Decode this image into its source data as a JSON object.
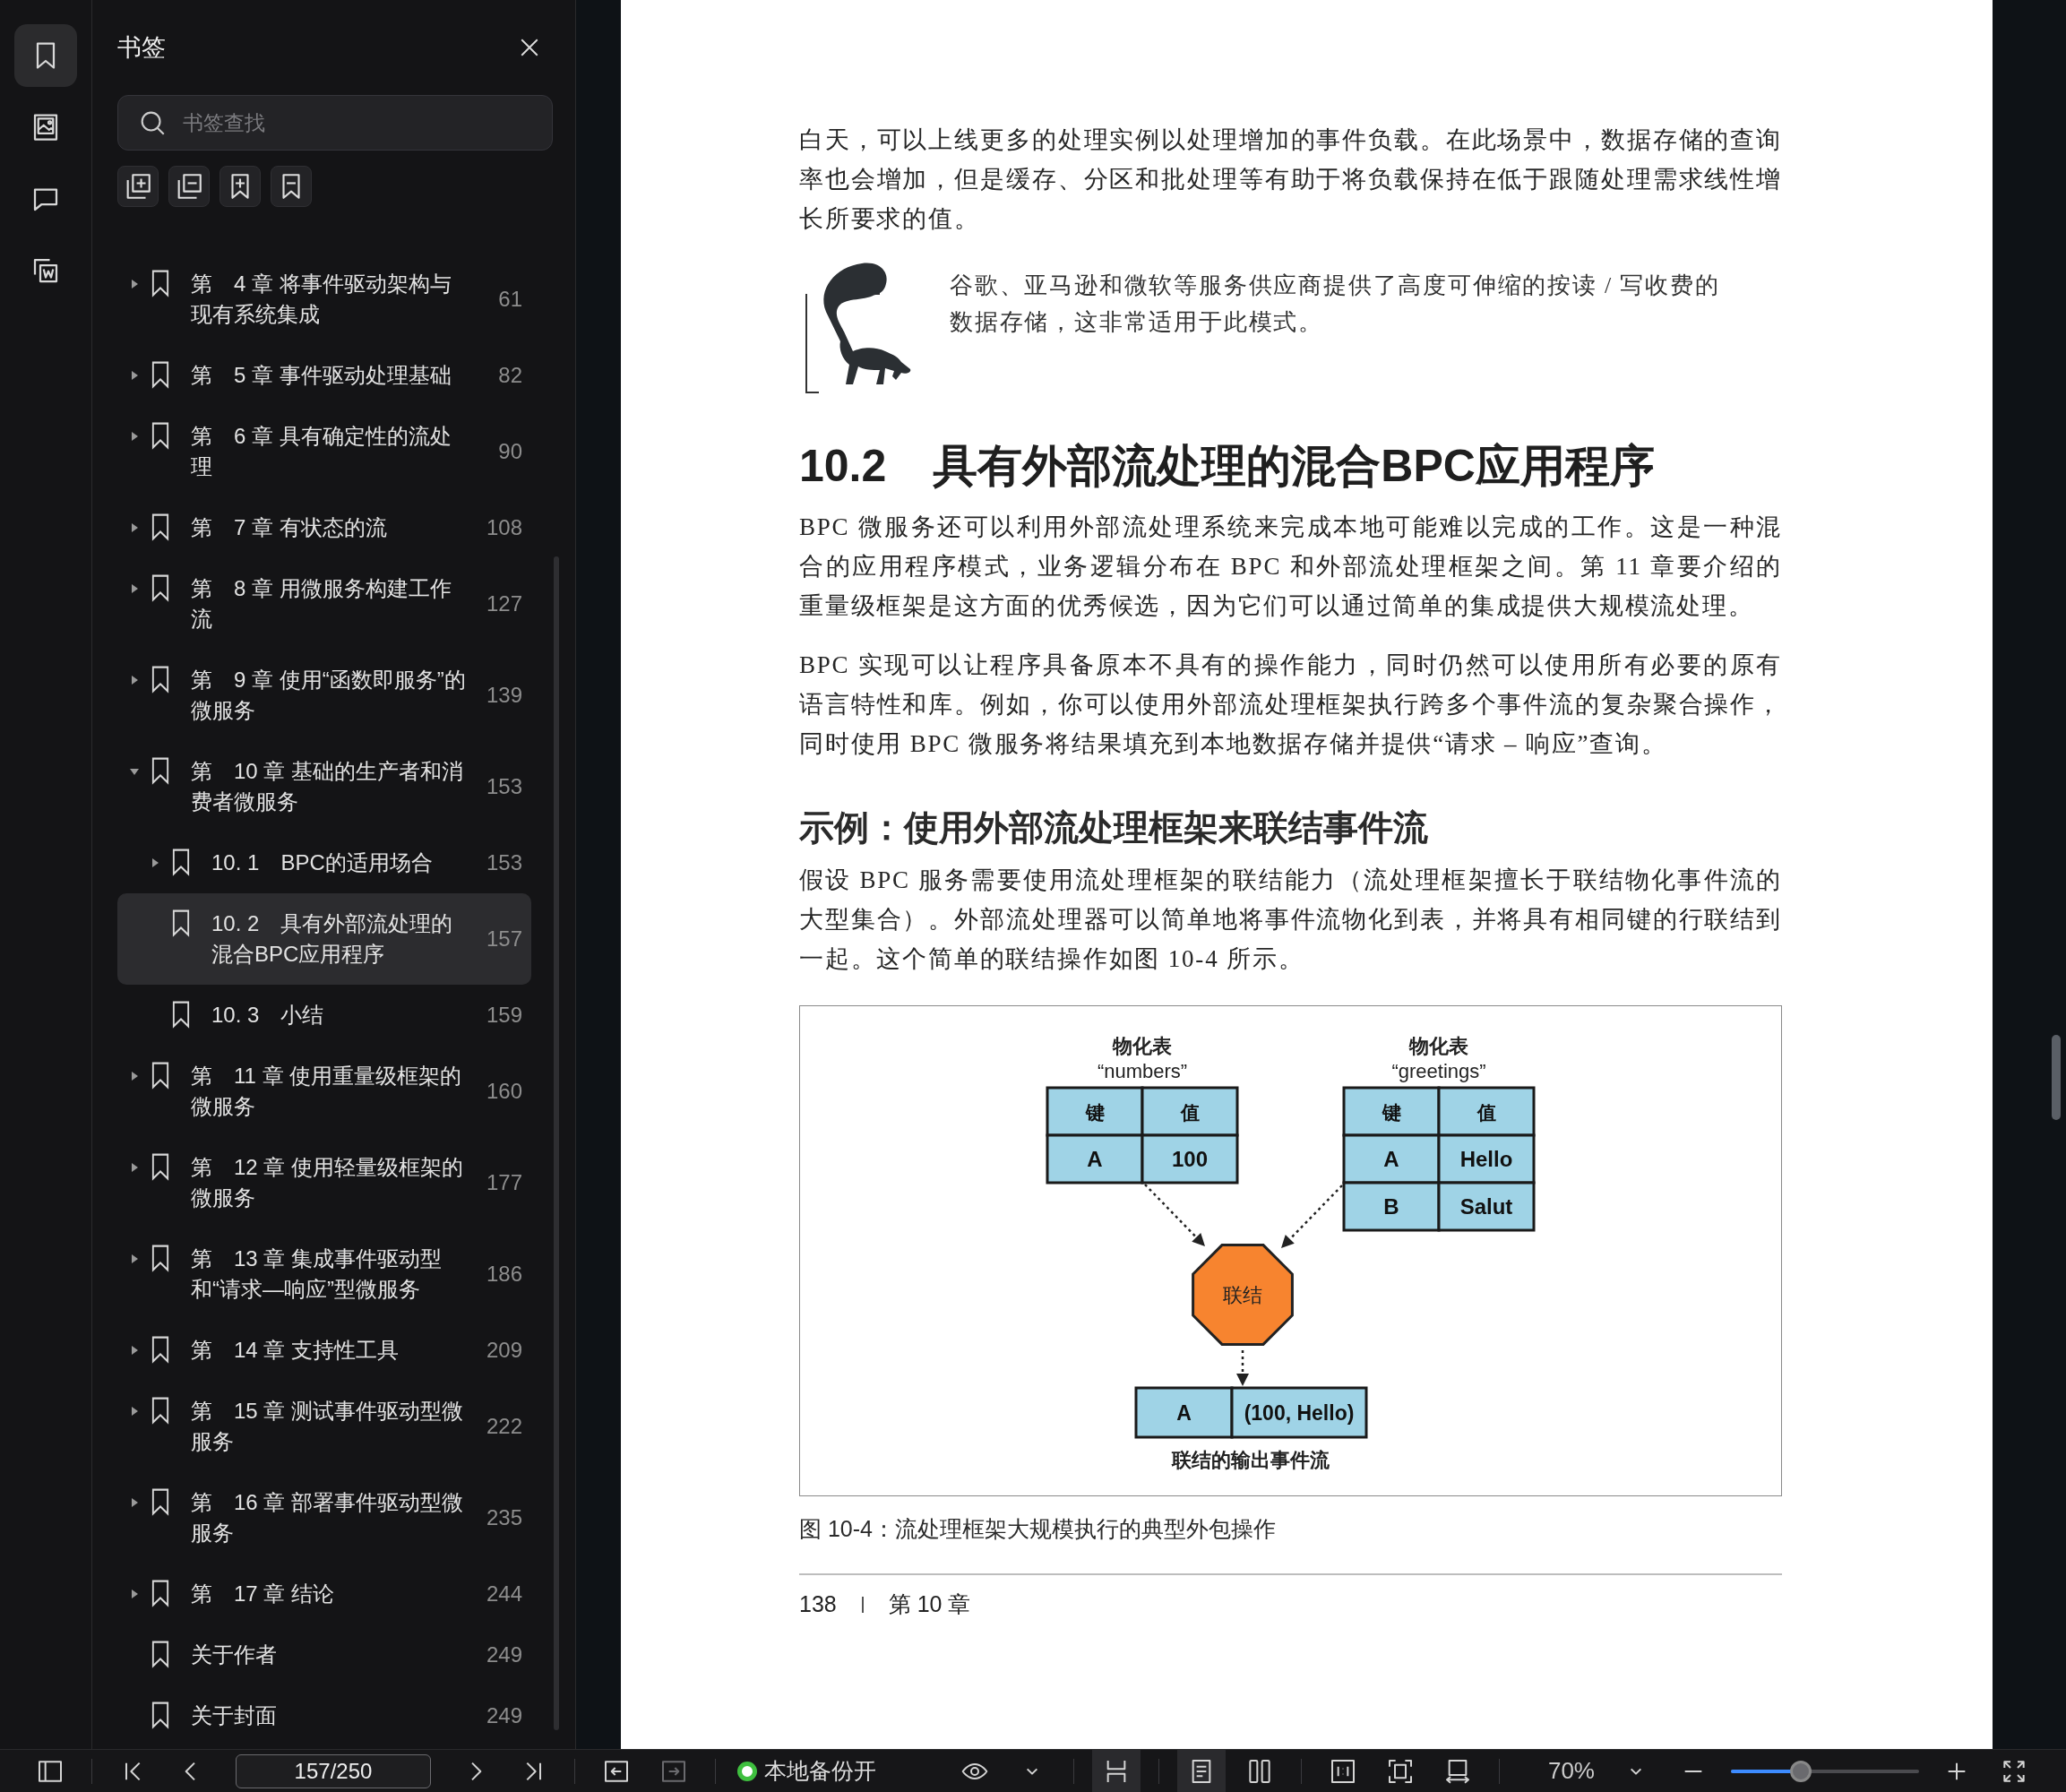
{
  "rail": [
    {
      "kind": "bookmark",
      "selected": true
    },
    {
      "kind": "image",
      "selected": false
    },
    {
      "kind": "comment",
      "selected": false
    },
    {
      "kind": "export",
      "selected": false
    }
  ],
  "sidebar": {
    "title": "书签",
    "search": {
      "placeholder": "书签查找"
    },
    "tools": [
      {
        "kind": "expand-all"
      },
      {
        "kind": "collapse-all"
      },
      {
        "kind": "bookmark-add"
      },
      {
        "kind": "bookmark-remove"
      }
    ],
    "bookmarks": [
      {
        "title": "第　4 章 将事件驱动架构与现有系统集成",
        "page": "61",
        "expanded": false,
        "selected": false
      },
      {
        "title": "第　5 章 事件驱动处理基础",
        "page": "82",
        "expanded": false,
        "selected": false
      },
      {
        "title": "第　6 章 具有确定性的流处理",
        "page": "90",
        "expanded": false,
        "selected": false
      },
      {
        "title": "第　7 章 有状态的流",
        "page": "108",
        "expanded": false,
        "selected": false
      },
      {
        "title": "第　8 章 用微服务构建工作流",
        "page": "127",
        "expanded": false,
        "selected": false
      },
      {
        "title": "第　9 章 使用“函数即服务”的微服务",
        "page": "139",
        "expanded": false,
        "selected": false
      },
      {
        "title": "第　10 章 基础的生产者和消费者微服务",
        "page": "153",
        "expanded": true,
        "selected": false,
        "children": [
          {
            "title": "10. 1　BPC的适用场合",
            "page": "153",
            "expanded": false,
            "selected": false
          },
          {
            "title": "10. 2　具有外部流处理的混合BPC应用程序",
            "page": "157",
            "selected": true
          },
          {
            "title": "10. 3　小结",
            "page": "159",
            "selected": false
          }
        ]
      },
      {
        "title": "第　11 章 使用重量级框架的微服务",
        "page": "160",
        "expanded": false,
        "selected": false
      },
      {
        "title": "第　12 章 使用轻量级框架的微服务",
        "page": "177",
        "expanded": false,
        "selected": false
      },
      {
        "title": "第　13 章 集成事件驱动型和“请求—响应”型微服务",
        "page": "186",
        "expanded": false,
        "selected": false
      },
      {
        "title": "第　14 章 支持性工具",
        "page": "209",
        "expanded": false,
        "selected": false
      },
      {
        "title": "第　15 章 测试事件驱动型微服务",
        "page": "222",
        "expanded": false,
        "selected": false
      },
      {
        "title": "第　16 章 部署事件驱动型微服务",
        "page": "235",
        "expanded": false,
        "selected": false
      },
      {
        "title": "第　17 章 结论",
        "page": "244",
        "expanded": false,
        "selected": false
      },
      {
        "title": "关于作者",
        "page": "249",
        "selected": false
      },
      {
        "title": "关于封面",
        "page": "249",
        "selected": false
      }
    ]
  },
  "page": {
    "blocks": [
      {
        "kind": "paragraph",
        "text": "白天，可以上线更多的处理实例以处理增加的事件负载。在此场景中，数据存储的查询率也会增加，但是缓存、分区和批处理等有助于将负载保持在低于跟随处理需求线性增长所要求的值。"
      },
      {
        "kind": "note",
        "text": "谷歌、亚马逊和微软等服务供应商提供了高度可伸缩的按读 / 写收费的数据存储，这非常适用于此模式。"
      },
      {
        "kind": "heading",
        "number": "10.2",
        "text": "具有外部流处理的混合BPC应用程序"
      },
      {
        "kind": "paragraph",
        "text": "BPC 微服务还可以利用外部流处理系统来完成本地可能难以完成的工作。这是一种混合的应用程序模式，业务逻辑分布在 BPC 和外部流处理框架之间。第 11 章要介绍的重量级框架是这方面的优秀候选，因为它们可以通过简单的集成提供大规模流处理。"
      },
      {
        "kind": "paragraph",
        "text": "BPC 实现可以让程序具备原本不具有的操作能力，同时仍然可以使用所有必要的原有语言特性和库。例如，你可以使用外部流处理框架执行跨多个事件流的复杂聚合操作，同时使用 BPC 微服务将结果填充到本地数据存储并提供“请求 – 响应”查询。"
      },
      {
        "kind": "subheading",
        "text": "示例：使用外部流处理框架来联结事件流"
      },
      {
        "kind": "paragraph",
        "text": "假设 BPC 服务需要使用流处理框架的联结能力（流处理框架擅长于联结物化事件流的大型集合）。外部流处理器可以简单地将事件流物化到表，并将具有相同键的行联结到一起。这个简单的联结操作如图 10-4 所示。"
      },
      {
        "kind": "figure",
        "tables": [
          {
            "title": "物化表",
            "name": "“numbers”",
            "header": [
              "键",
              "值"
            ],
            "rows": [
              [
                "A",
                "100"
              ]
            ]
          },
          {
            "title": "物化表",
            "name": "“greetings”",
            "header": [
              "键",
              "值"
            ],
            "rows": [
              [
                "A",
                "Hello"
              ],
              [
                "B",
                "Salut"
              ]
            ]
          }
        ],
        "operator": "联结",
        "output": {
          "cells": [
            "A",
            "(100, Hello)"
          ],
          "label": "联结的输出事件流"
        }
      },
      {
        "kind": "caption",
        "text": "图 10-4：流处理框架大规模执行的典型外包操作"
      }
    ],
    "footer": {
      "page_number": "138",
      "chapter": "第 10 章"
    }
  },
  "toolbar": {
    "items": [
      {
        "kind": "sidebar-toggle"
      },
      {
        "kind": "separator"
      },
      {
        "kind": "first"
      },
      {
        "kind": "prev"
      },
      {
        "kind": "page-field",
        "value": "157/250"
      },
      {
        "kind": "next"
      },
      {
        "kind": "last"
      },
      {
        "kind": "separator"
      },
      {
        "kind": "back",
        "disabled": false
      },
      {
        "kind": "forward",
        "disabled": true
      },
      {
        "kind": "separator"
      },
      {
        "kind": "status",
        "label": "本地备份开",
        "on": true
      },
      {
        "kind": "spacer"
      },
      {
        "kind": "eye"
      },
      {
        "kind": "caret"
      },
      {
        "kind": "separator"
      },
      {
        "kind": "scroll-mode",
        "selected": true
      },
      {
        "kind": "separator"
      },
      {
        "kind": "single-page",
        "selected": true
      },
      {
        "kind": "two-page",
        "selected": false
      },
      {
        "kind": "separator"
      },
      {
        "kind": "actual-size"
      },
      {
        "kind": "fit-page"
      },
      {
        "kind": "fit-width"
      },
      {
        "kind": "separator"
      },
      {
        "kind": "zoom",
        "value": "70%"
      },
      {
        "kind": "caret"
      },
      {
        "kind": "minus"
      },
      {
        "kind": "slider",
        "level": 0.37
      },
      {
        "kind": "plus"
      },
      {
        "kind": "fullscreen"
      }
    ]
  }
}
